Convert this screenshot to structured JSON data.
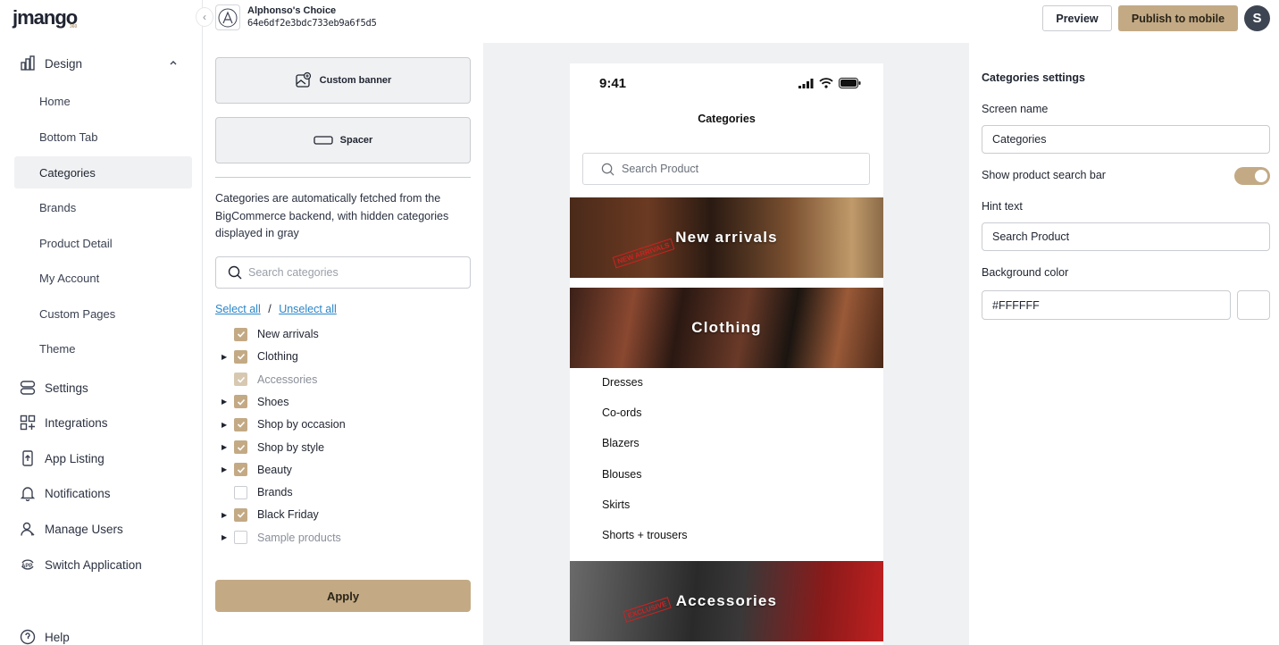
{
  "brand": {
    "logo": "jmango",
    "logo_sub": "360",
    "accent": "#c3aa85"
  },
  "sidebar": {
    "design_label": "Design",
    "design_items": [
      "Home",
      "Bottom Tab",
      "Categories",
      "Brands",
      "Product Detail",
      "My Account",
      "Custom Pages",
      "Theme"
    ],
    "active_item": "Categories",
    "nav_items": [
      "Settings",
      "Integrations",
      "App Listing",
      "Notifications",
      "Manage Users",
      "Switch Application"
    ],
    "help_label": "Help"
  },
  "header": {
    "app_name": "Alphonso's Choice",
    "app_id": "64e6df2e3bdc733eb9a6f5d5",
    "preview_label": "Preview",
    "publish_label": "Publish to mobile",
    "user_initial": "S"
  },
  "panel": {
    "custom_banner_label": "Custom banner",
    "spacer_label": "Spacer",
    "description": "Categories are automatically fetched from the BigCommerce backend, with hidden categories displayed in gray",
    "search_placeholder": "Search categories",
    "select_all": "Select all",
    "separator": "/",
    "unselect_all": "Unselect all",
    "categories": [
      {
        "label": "New arrivals",
        "checked": true,
        "expandable": false,
        "hidden": false
      },
      {
        "label": "Clothing",
        "checked": true,
        "expandable": true,
        "hidden": false
      },
      {
        "label": "Accessories",
        "checked": true,
        "expandable": false,
        "hidden": true
      },
      {
        "label": "Shoes",
        "checked": true,
        "expandable": true,
        "hidden": false
      },
      {
        "label": "Shop by occasion",
        "checked": true,
        "expandable": true,
        "hidden": false
      },
      {
        "label": "Shop by style",
        "checked": true,
        "expandable": true,
        "hidden": false
      },
      {
        "label": "Beauty",
        "checked": true,
        "expandable": true,
        "hidden": false
      },
      {
        "label": "Brands",
        "checked": false,
        "expandable": false,
        "hidden": false
      },
      {
        "label": "Black Friday",
        "checked": true,
        "expandable": true,
        "hidden": false
      },
      {
        "label": "Sample products",
        "checked": false,
        "expandable": true,
        "hidden": true
      }
    ],
    "apply_label": "Apply"
  },
  "phone": {
    "time": "9:41",
    "title": "Categories",
    "search_placeholder": "Search Product",
    "banners": [
      {
        "label": "New arrivals",
        "stamp": "NEW ARRIVALS"
      },
      {
        "label": "Clothing"
      },
      {
        "label": "Accessories",
        "stamp": "EXCLUSIVE"
      }
    ],
    "subcategories": [
      "Dresses",
      "Co-ords",
      "Blazers",
      "Blouses",
      "Skirts",
      "Shorts + trousers"
    ]
  },
  "settings": {
    "title": "Categories settings",
    "screen_name_label": "Screen name",
    "screen_name_value": "Categories",
    "search_bar_label": "Show product search bar",
    "search_bar_on": true,
    "hint_label": "Hint text",
    "hint_value": "Search Product",
    "bg_label": "Background color",
    "bg_value": "#FFFFFF"
  }
}
